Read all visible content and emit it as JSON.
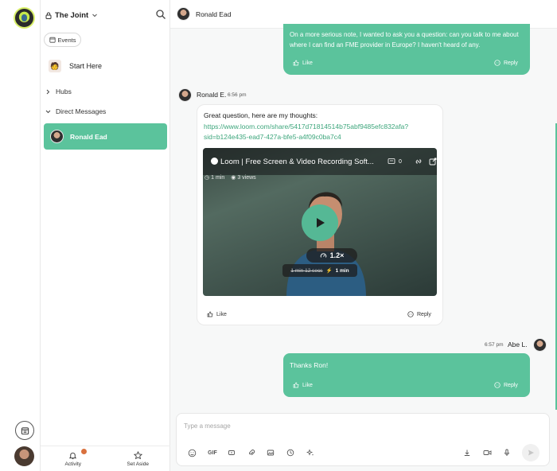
{
  "workspace": {
    "name": "The Joint"
  },
  "sidebar": {
    "events_label": "Events",
    "start_here_label": "Start Here",
    "hubs_label": "Hubs",
    "dm_label": "Direct Messages",
    "dm_items": [
      {
        "name": "Ronald Ead"
      }
    ],
    "bottom_tabs": [
      {
        "label": "Activity"
      },
      {
        "label": "Set Aside"
      }
    ]
  },
  "conversation": {
    "title": "Ronald Ead"
  },
  "messages": [
    {
      "text": "On a more serious note, I wanted to ask you a question: can you talk to me about where I can find an FME provider in Europe? I haven't heard of any.",
      "like_label": "Like",
      "reply_label": "Reply"
    },
    {
      "author": "Ronald E.",
      "time": "6:56 pm",
      "text": "Great question, here are my thoughts:",
      "link": "https://www.loom.com/share/5417d7181451 4b75abf9485efc832afa?sid=b124e435-ead7-427a-bfe5-a4f09c0ba7c4",
      "link_line1": "https://www.loom.com/share/5417d71814514b75abf9485efc832afa?",
      "link_line2": "sid=b124e435-ead7-427a-bfe5-a4f09c0ba7c4",
      "video": {
        "title": "Loom | Free Screen & Video Recording Soft...",
        "comments": "0",
        "length": "1 min",
        "views": "3 views",
        "speed": "1.2×",
        "original_duration": "1 min 12 secs",
        "new_duration": "1 min"
      },
      "like_label": "Like",
      "reply_label": "Reply"
    },
    {
      "author": "Abe L.",
      "time": "6:57 pm",
      "text": "Thanks Ron!",
      "like_label": "Like",
      "reply_label": "Reply"
    }
  ],
  "composer": {
    "placeholder": "Type a message",
    "gif_label": "GIF"
  },
  "colors": {
    "accent": "#5bc39c",
    "badge": "#d9713e"
  }
}
